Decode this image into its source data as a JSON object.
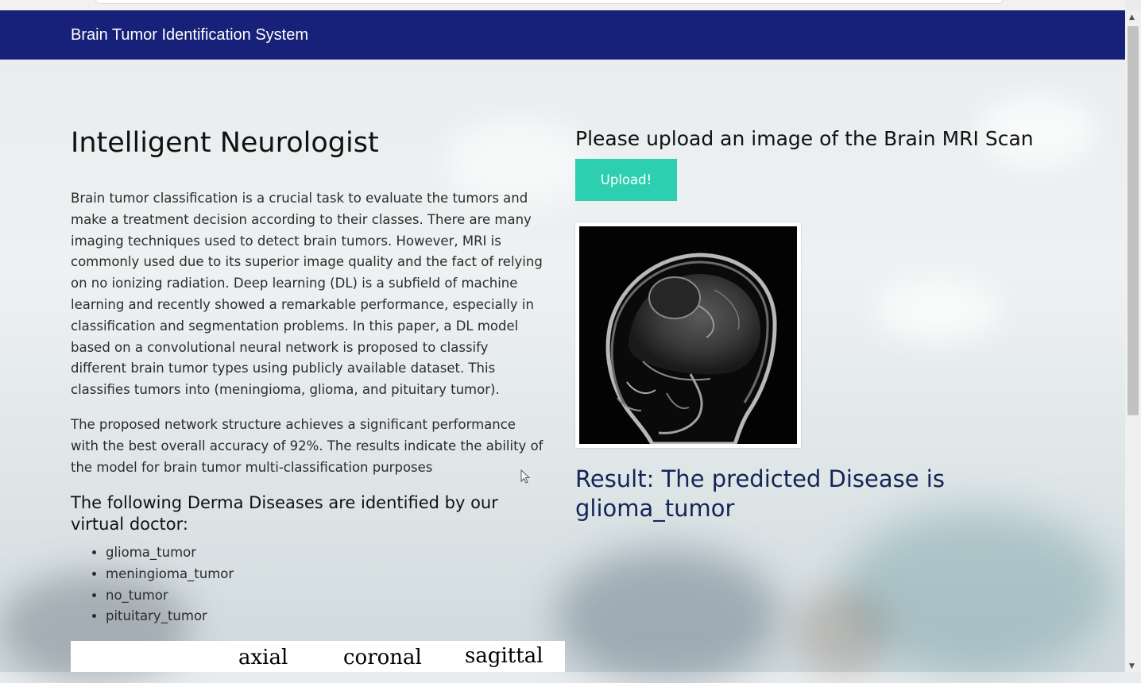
{
  "navbar": {
    "brand": "Brain Tumor Identification System"
  },
  "left": {
    "title": "Intelligent Neurologist",
    "paragraph_1": "Brain tumor classification is a crucial task to evaluate the tumors and make a treatment decision according to their classes. There are many imaging techniques used to detect brain tumors. However, MRI is commonly used due to its superior image quality and the fact of relying on no ionizing radiation. Deep learning (DL) is a subfield of machine learning and recently showed a remarkable performance, especially in classification and segmentation problems. In this paper, a DL model based on a convolutional neural network is proposed to classify different brain tumor types using publicly available dataset. This classifies tumors into (meningioma, glioma, and pituitary tumor).",
    "paragraph_2": "The proposed network structure achieves a significant performance with the best overall accuracy of 92%. The results indicate the ability of the model for brain tumor multi-classification purposes",
    "diseases_heading": "The following Derma Diseases are identified by our virtual doctor:",
    "diseases": [
      "glioma_tumor",
      "meningioma_tumor",
      "no_tumor",
      "pituitary_tumor"
    ],
    "views": [
      "axial",
      "coronal",
      "sagittal"
    ]
  },
  "right": {
    "upload_title": "Please upload an image of the Brain MRI Scan",
    "upload_button": "Upload!",
    "result_text": "Result: The predicted Disease is glioma_tumor"
  },
  "colors": {
    "navbar": "#182179",
    "upload_button": "#2ecfb0",
    "result_text": "#152456"
  },
  "icons": [
    "mouse-cursor-icon",
    "scroll-up-arrow-icon",
    "scroll-down-arrow-icon"
  ]
}
